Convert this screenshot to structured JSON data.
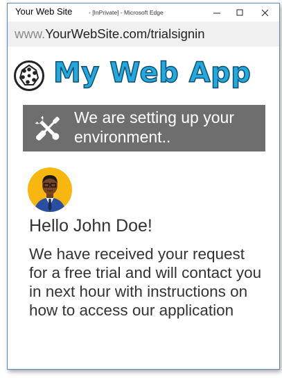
{
  "window": {
    "title": "Your Web Site",
    "subtitle": "- [InPrivate] - Microsoft Edge",
    "controls": {
      "minimize": "—",
      "maximize": "☐",
      "close": "✕"
    }
  },
  "address_bar": {
    "protocol": "www.",
    "rest": "YourWebSite.com/trialsignin"
  },
  "app": {
    "name": "My Web App",
    "accent_color": "#22a9dd"
  },
  "banner": {
    "text": "We are setting up your environment..",
    "background": "#6e6e6e",
    "icon": "tools-icon"
  },
  "user": {
    "greeting": "Hello John Doe!",
    "avatar_icon": "user-avatar"
  },
  "message": "We have received your request for a free trial and will contact you in next hour with instructions on how to access our application"
}
